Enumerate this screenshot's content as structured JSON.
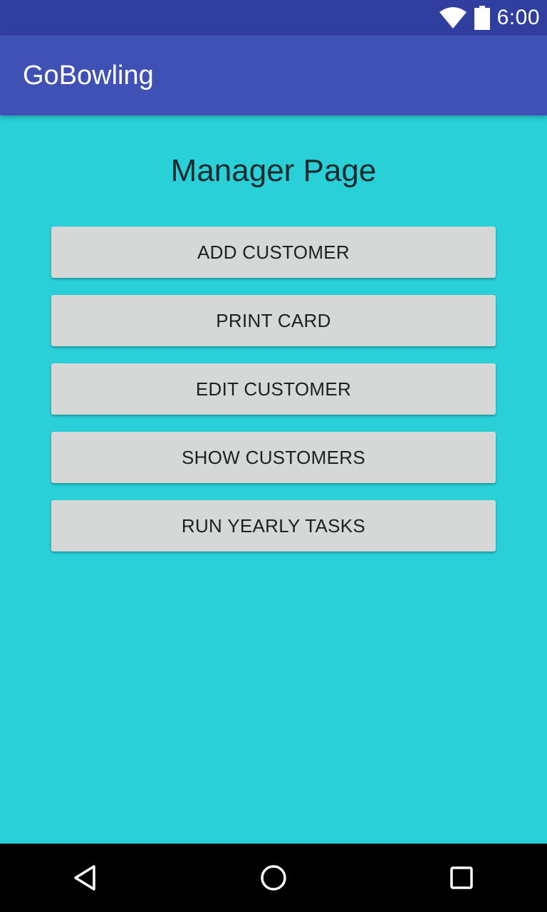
{
  "status_bar": {
    "time": "6:00",
    "icons": [
      "wifi-icon",
      "battery-icon"
    ],
    "background": "#303f9f"
  },
  "app_bar": {
    "title": "GoBowling",
    "background": "#3f51b5"
  },
  "main": {
    "title": "Manager Page",
    "background": "#29d0d8",
    "buttons": [
      {
        "label": "ADD CUSTOMER"
      },
      {
        "label": "PRINT CARD"
      },
      {
        "label": "EDIT CUSTOMER"
      },
      {
        "label": "SHOW CUSTOMERS"
      },
      {
        "label": "RUN YEARLY TASKS"
      }
    ]
  },
  "nav_bar": {
    "icons": [
      "back-icon",
      "home-icon",
      "recents-icon"
    ]
  }
}
